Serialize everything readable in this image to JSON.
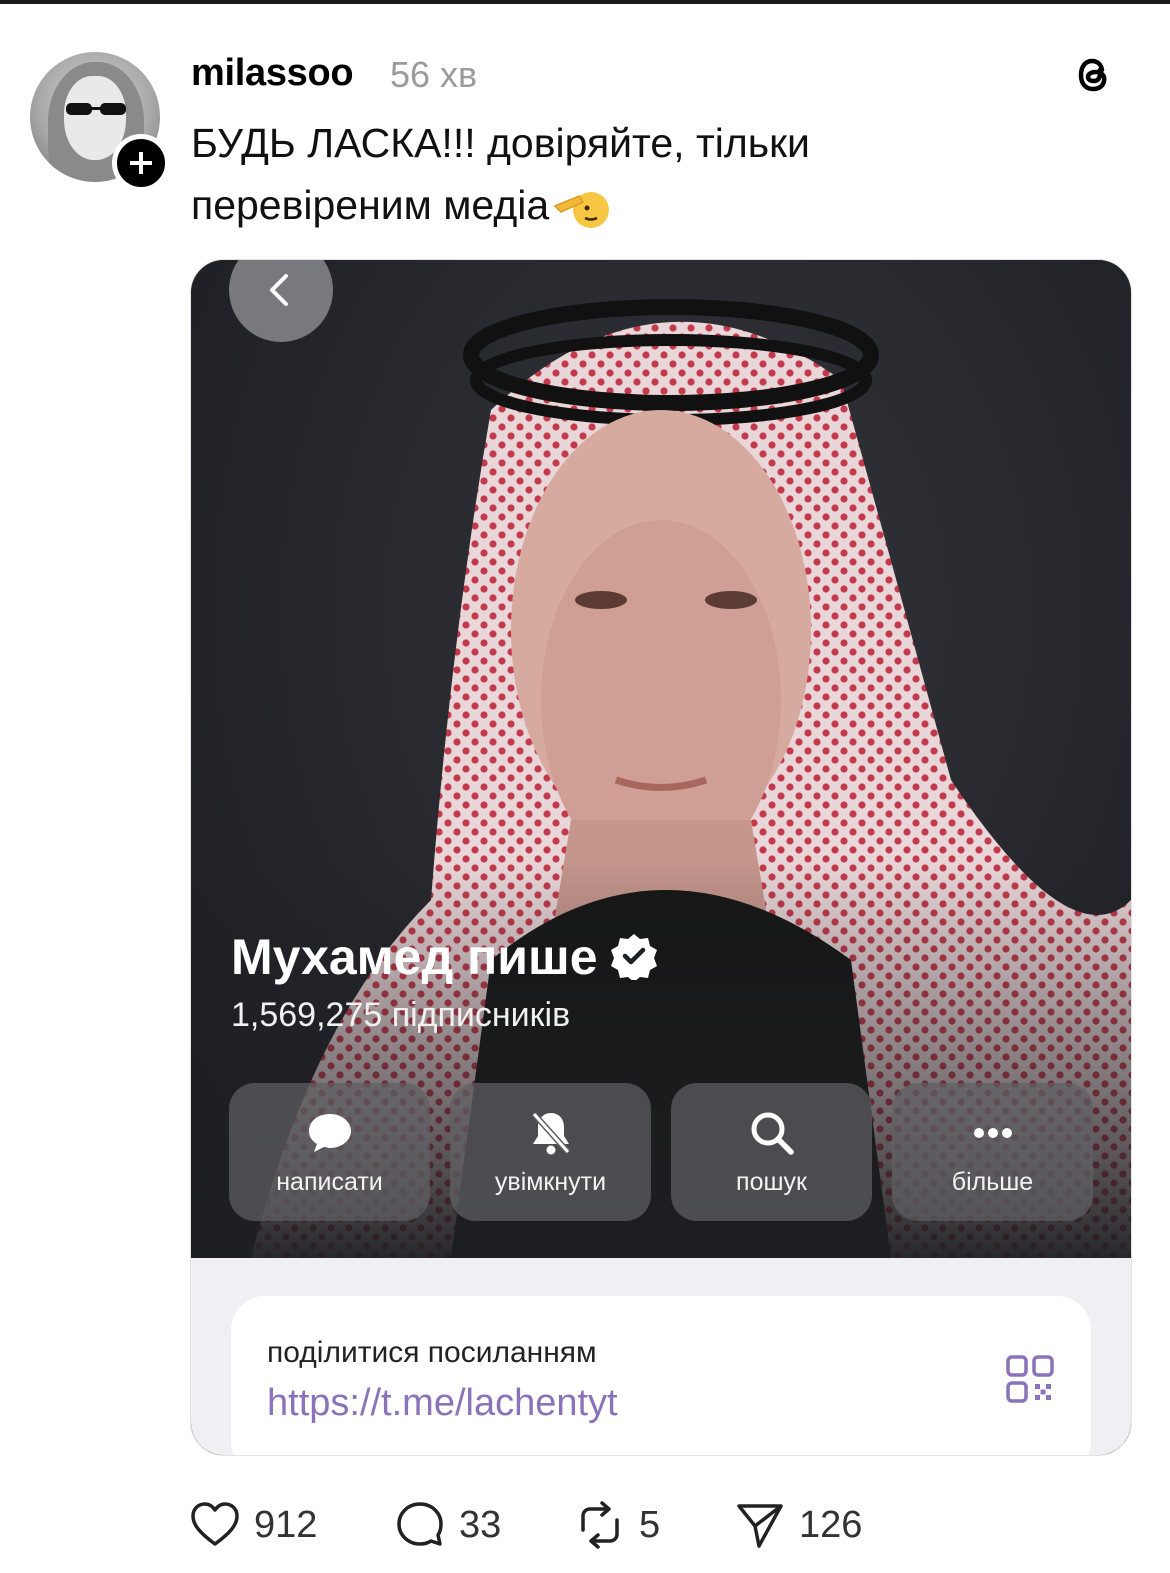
{
  "post": {
    "username": "milassoo",
    "time": "56 хв",
    "text_line1": "БУДЬ ЛАСКА!!! довіряйте, тільки",
    "text_line2": "перевіреним медіа"
  },
  "icons": {
    "avatar": "user-avatar",
    "follow": "plus-icon",
    "app": "threads-logo-icon",
    "emoji": "saluting-face-emoji",
    "back": "chevron-left-icon",
    "verified": "verified-badge-icon",
    "message": "chat-bubble-icon",
    "mute": "bell-off-icon",
    "search": "search-icon",
    "more": "more-dots-icon",
    "qr": "qr-code-icon",
    "like": "heart-icon",
    "reply": "comment-icon",
    "repost": "repost-icon",
    "share": "send-icon"
  },
  "channel": {
    "name": "Мухамед пише",
    "subscribers": "1,569,275 підписників",
    "actions": [
      {
        "label": "написати"
      },
      {
        "label": "увімкнути"
      },
      {
        "label": "пошук"
      },
      {
        "label": "більше"
      }
    ],
    "share_label": "поділитися посиланням",
    "share_link": "https://t.me/lachentyt"
  },
  "stats": {
    "likes": "912",
    "replies": "33",
    "reposts": "5",
    "shares": "126"
  },
  "colors": {
    "link": "#8a73b8",
    "muted": "#9b9b9b",
    "button_bg": "#5f5f64"
  }
}
